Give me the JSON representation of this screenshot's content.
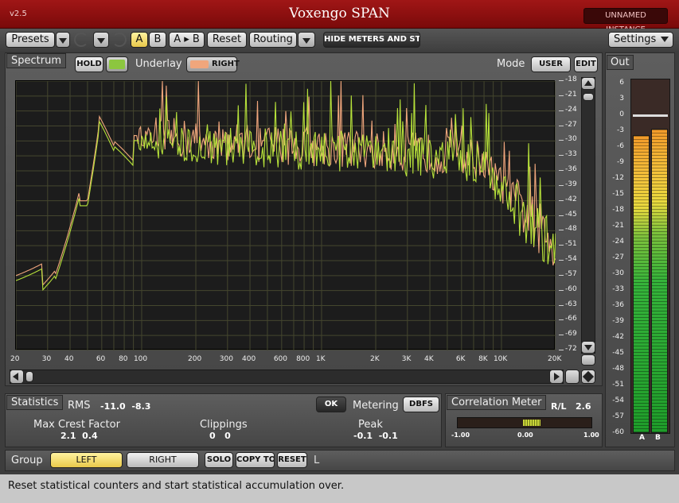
{
  "titlebar": {
    "version": "v2.5",
    "title": "Voxengo SPAN",
    "instance": "UNNAMED INSTANCE"
  },
  "toolbar": {
    "presets": "Presets",
    "ab_a": "A",
    "ab_b": "B",
    "ab_copy": "A ▸ B",
    "reset": "Reset",
    "routing": "Routing",
    "hide_meters": "HIDE METERS AND STATS",
    "settings": "Settings"
  },
  "spectrum": {
    "title": "Spectrum",
    "hold": "HOLD",
    "underlay": "Underlay",
    "underlay_channel": "RIGHT",
    "mode_label": "Mode",
    "mode_value": "USER",
    "edit": "EDIT",
    "y_ticks": [
      "-18",
      "-21",
      "-24",
      "-27",
      "-30",
      "-33",
      "-36",
      "-39",
      "-42",
      "-45",
      "-48",
      "-51",
      "-54",
      "-57",
      "-60",
      "-63",
      "-66",
      "-69",
      "-72"
    ],
    "x_ticks": [
      "20",
      "30",
      "40",
      "60",
      "80",
      "100",
      "200",
      "300",
      "400",
      "600",
      "800",
      "1K",
      "2K",
      "3K",
      "4K",
      "6K",
      "8K",
      "10K",
      "20K"
    ],
    "colors": {
      "main": "#b6e13a",
      "underlay": "#f0a67c",
      "grid": "#44462e"
    }
  },
  "out": {
    "title": "Out",
    "ticks": [
      "6",
      "3",
      "0",
      "-3",
      "-6",
      "-9",
      "-12",
      "-15",
      "-18",
      "-21",
      "-24",
      "-27",
      "-30",
      "-33",
      "-36",
      "-39",
      "-42",
      "-45",
      "-48",
      "-51",
      "-54",
      "-57",
      "-60"
    ],
    "channel_a": "A",
    "channel_b": "B"
  },
  "statistics": {
    "title": "Statistics",
    "rms_label": "RMS",
    "rms_values": "-11.0  -8.3",
    "ok": "OK",
    "metering_label": "Metering",
    "metering_value": "DBFS",
    "crest_label": "Max Crest Factor",
    "crest_values": "2.1  0.4",
    "clip_label": "Clippings",
    "clip_values": "0   0",
    "peak_label": "Peak",
    "peak_values": "-0.1  -0.1"
  },
  "correlation": {
    "title": "Correlation Meter",
    "mode": "R/L",
    "value": "2.6",
    "scale_min": "-1.00",
    "scale_mid": "0.00",
    "scale_max": "1.00"
  },
  "group": {
    "label": "Group",
    "left": "LEFT",
    "right": "RIGHT",
    "solo": "SOLO",
    "copy": "COPY TO",
    "reset": "RESET",
    "indicator": "L"
  },
  "status": "Reset statistical counters and start statistical accumulation over."
}
